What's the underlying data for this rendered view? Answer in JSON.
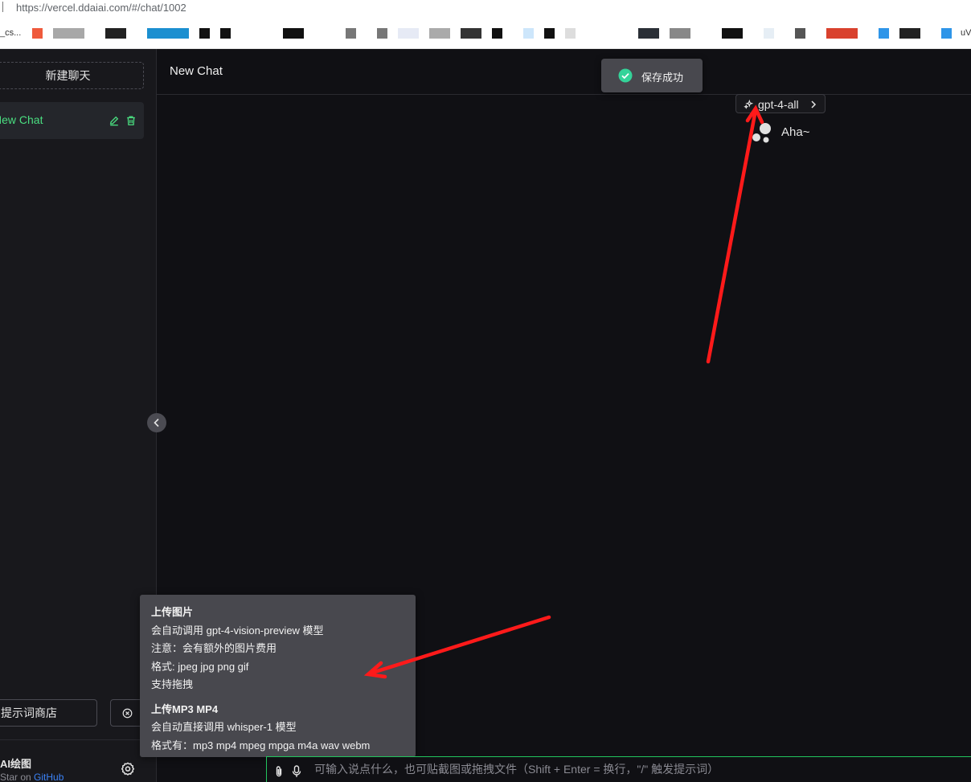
{
  "browser": {
    "url": "https://vercel.ddaiai.com/#/chat/1002",
    "bookmark_first": "_cs...",
    "bookmark_last": "uV"
  },
  "sidebar": {
    "new_chat_label": "新建聊天",
    "chats": [
      {
        "title": "New Chat",
        "active": true
      }
    ],
    "prompt_store_label": "提示词商店",
    "app_name": "AI绘图",
    "star_prefix": "Star on ",
    "star_link": "GitHub"
  },
  "header": {
    "title": "New Chat"
  },
  "toast": {
    "message": "保存成功"
  },
  "model": {
    "name": "gpt-4-all"
  },
  "assistant": {
    "greeting": "Aha~"
  },
  "tooltip": {
    "upload_image": {
      "title": "上传图片",
      "lines": [
        "会自动调用 gpt-4-vision-preview 模型",
        "注意：会有额外的图片费用",
        "格式: jpeg jpg png gif",
        "支持拖拽"
      ]
    },
    "upload_audio": {
      "title": "上传MP3 MP4",
      "lines": [
        "会自动直接调用 whisper-1 模型",
        "格式有：mp3 mp4 mpeg mpga m4a wav webm"
      ]
    }
  },
  "input": {
    "placeholder": "可输入说点什么，也可贴截图或拖拽文件（Shift + Enter = 换行，\"/\" 触发提示词）"
  },
  "colors": {
    "accent": "#22c55e",
    "active_chat": "#4ade80",
    "link": "#3b82f6",
    "annotation_arrow": "#ff1a1a"
  }
}
